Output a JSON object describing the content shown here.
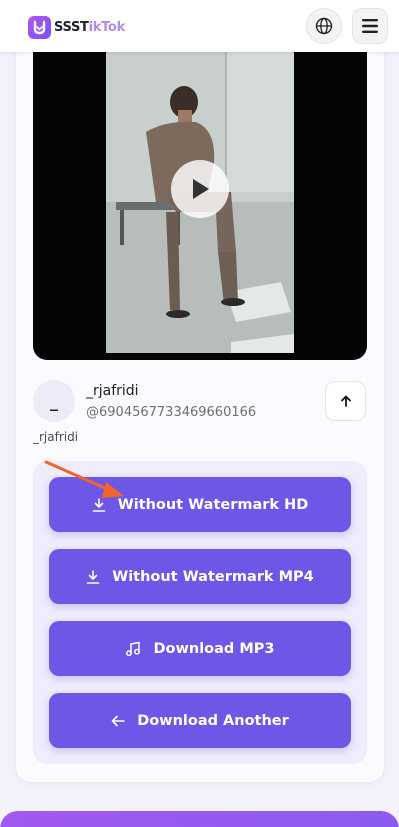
{
  "header": {
    "brand_primary": "SSST",
    "brand_accent": "ikTok",
    "globe_icon": "globe-icon",
    "menu_icon": "hamburger-menu-icon"
  },
  "video": {
    "play_icon": "play-icon"
  },
  "author": {
    "avatar_initial": "_",
    "name": "_rjafridi",
    "handle": "@6904567733469660166",
    "caption": "_rjafridi",
    "share_icon": "arrow-up-icon"
  },
  "downloads": {
    "hd_label": "Without Watermark HD",
    "mp4_label": "Without Watermark MP4",
    "mp3_label": "Download MP3",
    "another_label": "Download Another"
  },
  "colors": {
    "button": "#6d57e6",
    "panel": "#efecfd",
    "brand_accent": "#b48be8",
    "annotation_arrow": "#f0642a"
  }
}
